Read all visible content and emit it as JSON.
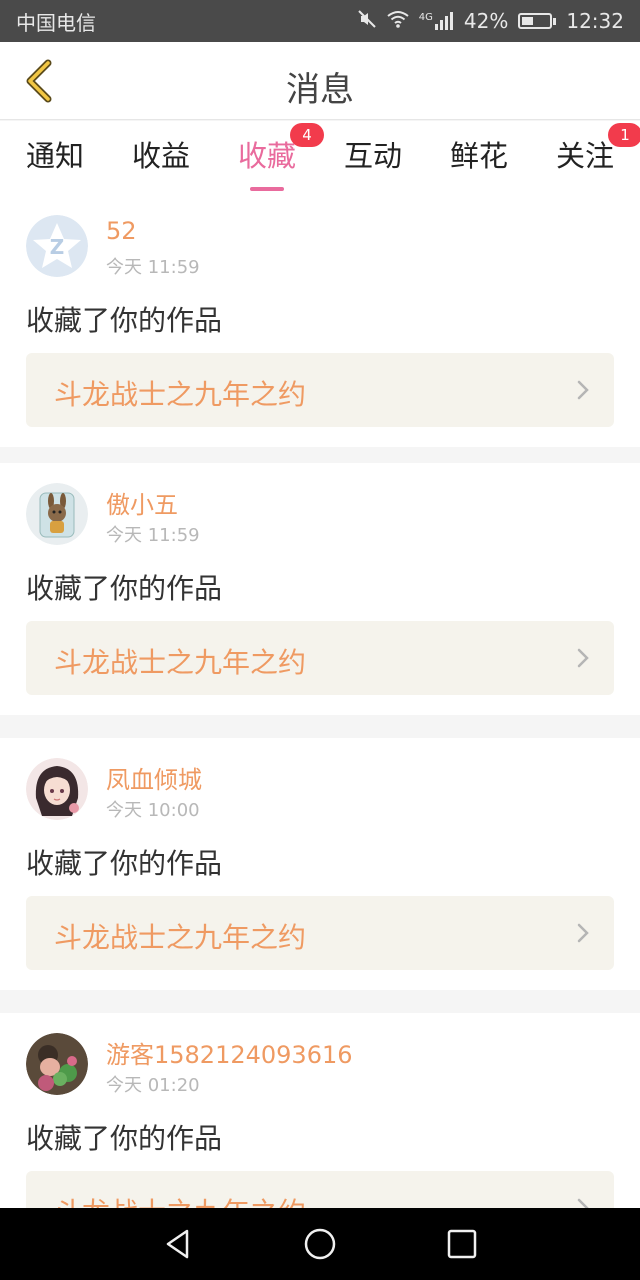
{
  "status_bar": {
    "carrier": "中国电信",
    "network": "4G",
    "battery": "42%",
    "battery_level": 0.42,
    "time": "12:32"
  },
  "header": {
    "title": "消息"
  },
  "tabs": [
    {
      "label": "通知",
      "badge": ""
    },
    {
      "label": "收益",
      "badge": ""
    },
    {
      "label": "收藏",
      "badge": "4",
      "active": true
    },
    {
      "label": "互动",
      "badge": ""
    },
    {
      "label": "鲜花",
      "badge": ""
    },
    {
      "label": "关注",
      "badge": "1"
    }
  ],
  "feed": [
    {
      "username": "52",
      "time": "今天 11:59",
      "action": "收藏了你的作品",
      "work_title": "斗龙战士之九年之约",
      "avatar": "default-avatar"
    },
    {
      "username": "傲小五",
      "time": "今天 11:59",
      "action": "收藏了你的作品",
      "work_title": "斗龙战士之九年之约",
      "avatar": "doll-avatar"
    },
    {
      "username": "凤血倾城",
      "time": "今天 10:00",
      "action": "收藏了你的作品",
      "work_title": "斗龙战士之九年之约",
      "avatar": "anime-girl-avatar"
    },
    {
      "username": "游客1582124093616",
      "time": "今天 01:20",
      "action": "收藏了你的作品",
      "work_title": "斗龙战士之九年之约",
      "avatar": "photo-avatar"
    }
  ],
  "colors": {
    "accent_pink": "#e96b9d",
    "accent_orange": "#ef9a62",
    "badge_red": "#f23b4c",
    "status_bar": "#4a4a4a"
  }
}
